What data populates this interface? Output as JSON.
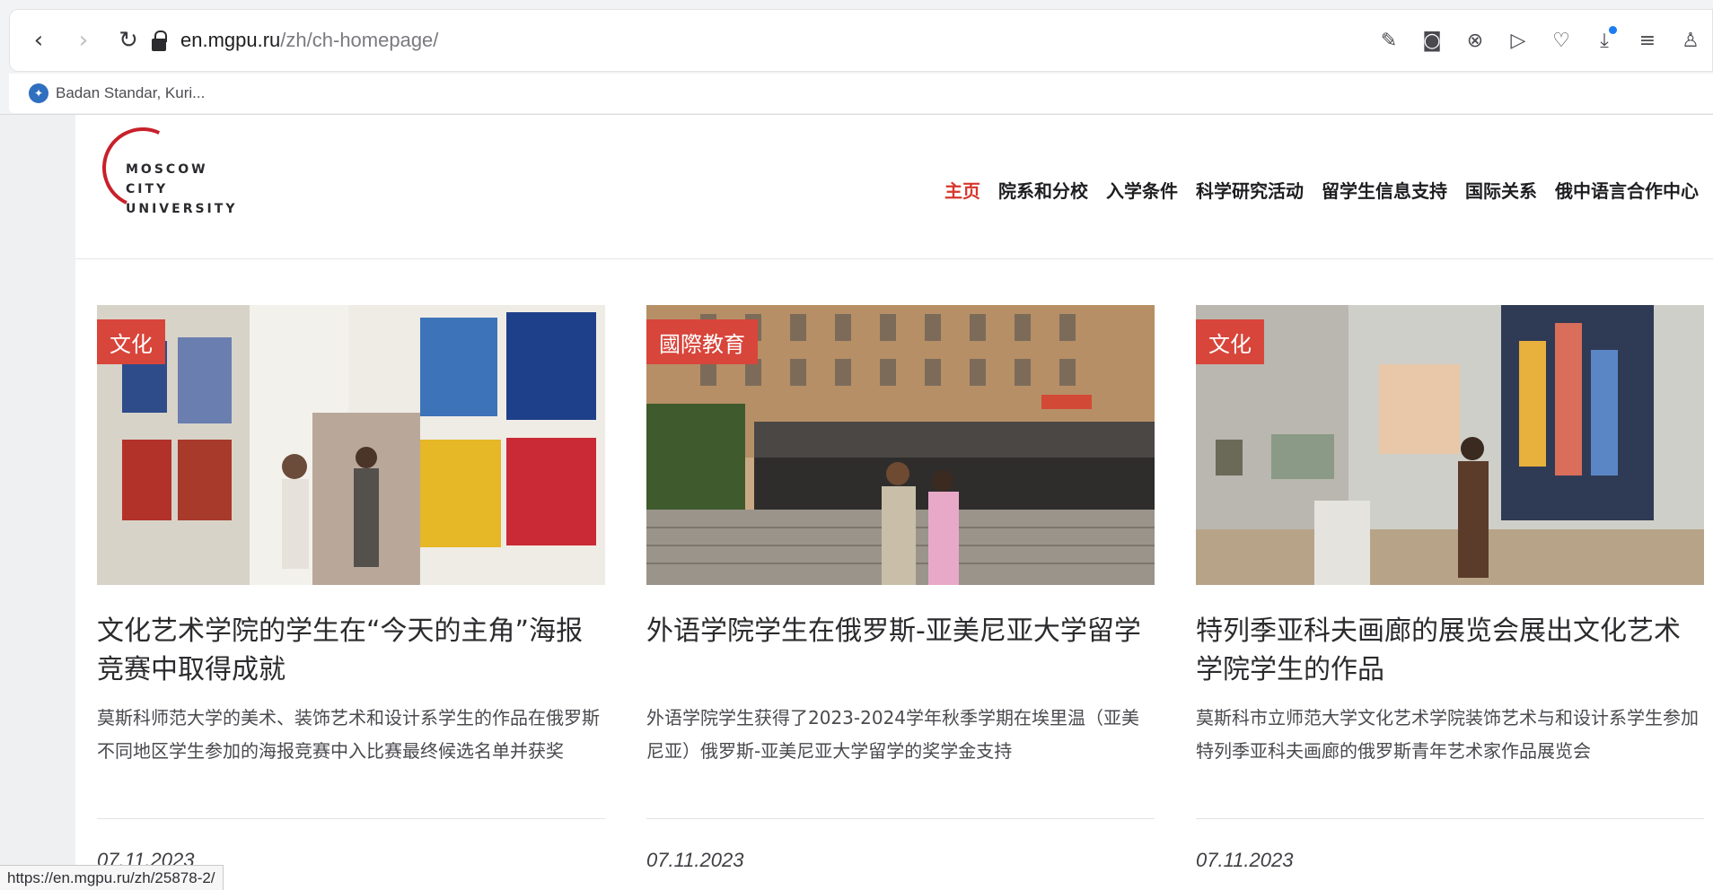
{
  "browser": {
    "url_host": "en.mgpu.ru",
    "url_path": "/zh/ch-homepage/",
    "toolbar_icons": [
      "edit-icon",
      "camera-icon",
      "close-circle-icon",
      "play-icon",
      "heart-icon",
      "download-icon",
      "menu-icon",
      "profile-icon"
    ],
    "bookmark_label": "Badan Standar, Kuri...",
    "status_url": "https://en.mgpu.ru/zh/25878-2/"
  },
  "site": {
    "logo": [
      "MOSCOW",
      "CITY",
      "UNIVERSITY"
    ],
    "nav": [
      {
        "label": "主页",
        "active": true
      },
      {
        "label": "院系和分校",
        "active": false
      },
      {
        "label": "入学条件",
        "active": false
      },
      {
        "label": "科学研究活动",
        "active": false
      },
      {
        "label": "留学生信息支持",
        "active": false
      },
      {
        "label": "国际关系",
        "active": false
      },
      {
        "label": "俄中语言合作中心",
        "active": false
      }
    ],
    "accent_color": "#d8362c"
  },
  "cards": [
    {
      "tag": "文化",
      "title": "文化艺术学院的学生在“今天的主角”海报竞赛中取得成就",
      "desc": "莫斯科师范大学的美术、装饰艺术和设计系学生的作品在俄罗斯不同地区学生参加的海报竞赛中入比赛最终候选名单并获奖",
      "date": "07.11.2023"
    },
    {
      "tag": "國際教育",
      "title": "外语学院学生在俄罗斯-亚美尼亚大学留学",
      "desc": "外语学院学生获得了2023-2024学年秋季学期在埃里温（亚美尼亚）俄罗斯-亚美尼亚大学留学的奖学金支持",
      "date": "07.11.2023"
    },
    {
      "tag": "文化",
      "title": "特列季亚科夫画廊的展览会展出文化艺术学院学生的作品",
      "desc": "莫斯科市立师范大学文化艺术学院装饰艺术与和设计系学生参加特列季亚科夫画廊的俄罗斯青年艺术家作品展览会",
      "date": "07.11.2023"
    }
  ]
}
